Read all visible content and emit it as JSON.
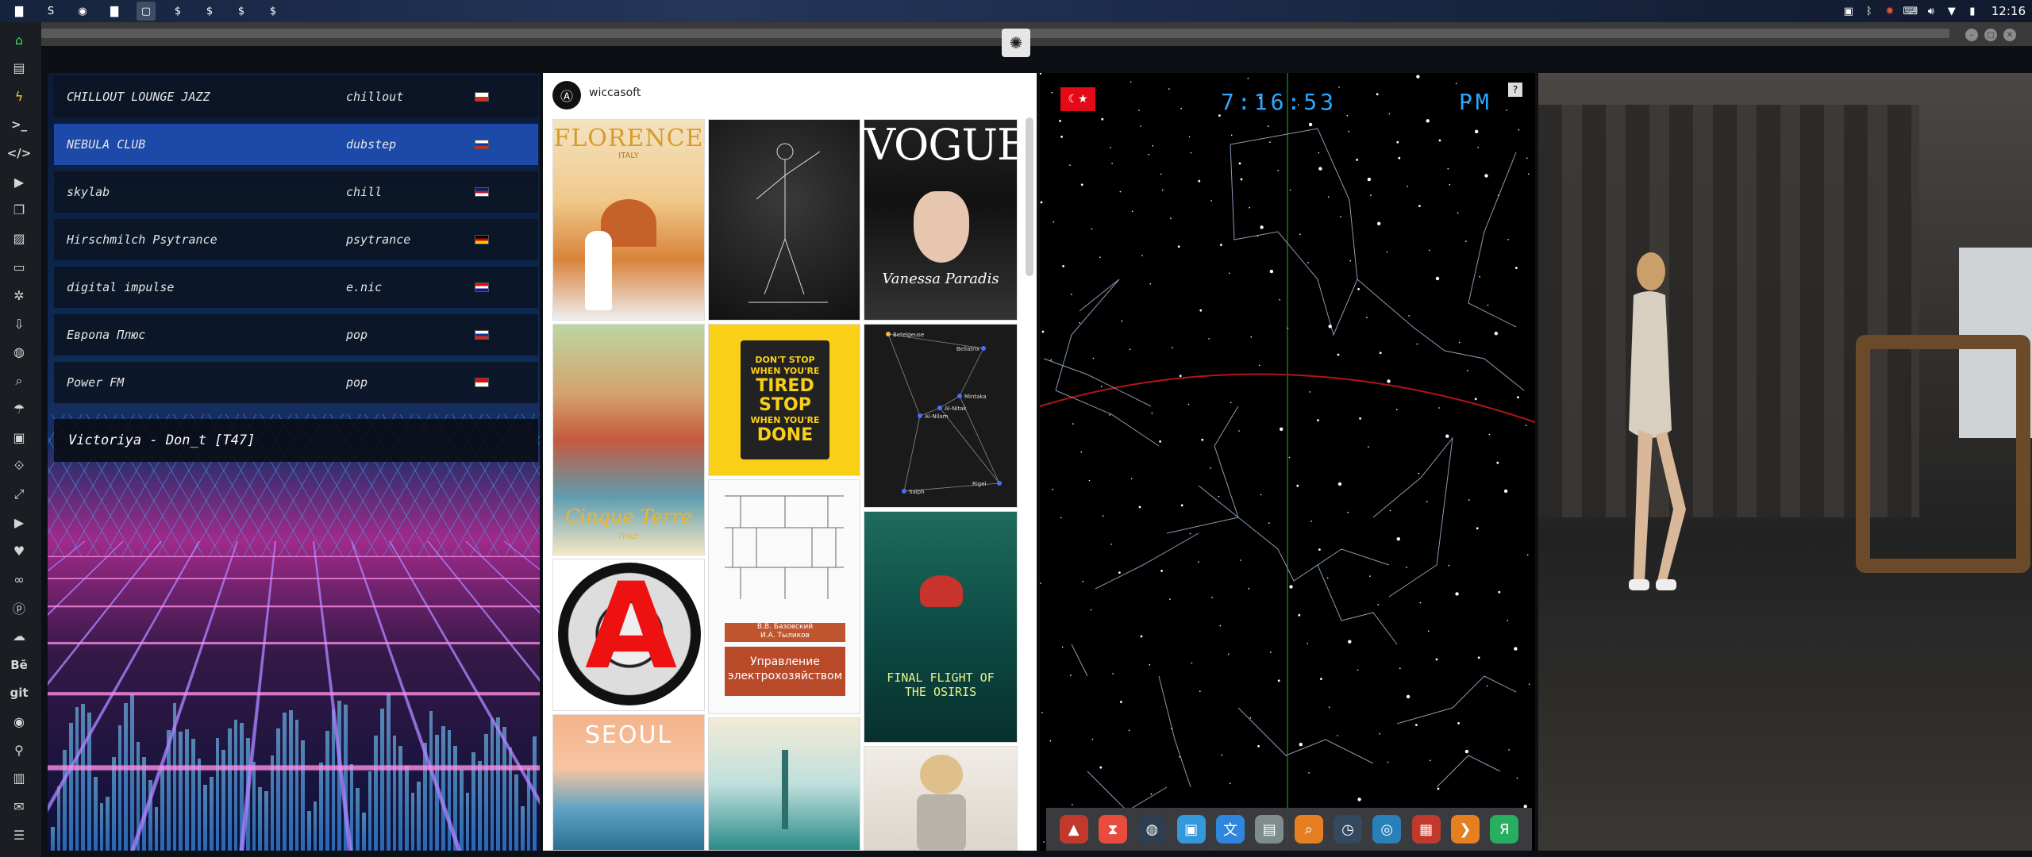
{
  "topbar": {
    "apps": [
      {
        "name": "files-icon",
        "glyph": "▇"
      },
      {
        "name": "sublime-icon",
        "glyph": "S"
      },
      {
        "name": "chrome-icon",
        "glyph": "◉"
      },
      {
        "name": "folder-icon",
        "glyph": "▇"
      },
      {
        "name": "window-icon",
        "glyph": "▢"
      },
      {
        "name": "app-icon",
        "glyph": "$"
      },
      {
        "name": "app-icon",
        "glyph": "$"
      },
      {
        "name": "app-icon",
        "glyph": "$"
      },
      {
        "name": "app-icon",
        "glyph": "$"
      }
    ],
    "clock": "12:16"
  },
  "window": {
    "logo_glyph": "✺"
  },
  "radio": {
    "stations": [
      {
        "name": "CHILLOUT LOUNGE JAZZ",
        "genre": "chillout",
        "flag_colors": [
          "#ffffff",
          "#d52b1e"
        ]
      },
      {
        "name": "NEBULA CLUB",
        "genre": "dubstep",
        "flag_colors": [
          "#ffffff",
          "#0039a6",
          "#d52b1e"
        ]
      },
      {
        "name": "skylab",
        "genre": "chill",
        "flag_colors": [
          "#012169",
          "#c8102e",
          "#ffffff"
        ]
      },
      {
        "name": "Hirschmilch Psytrance",
        "genre": "psytrance",
        "flag_colors": [
          "#000000",
          "#dd0000",
          "#ffce00"
        ]
      },
      {
        "name": "digital impulse",
        "genre": "e.nic",
        "flag_colors": [
          "#ff0000",
          "#ffffff",
          "#171796"
        ]
      },
      {
        "name": "Европа Плюс",
        "genre": "pop",
        "flag_colors": [
          "#ffffff",
          "#0039a6",
          "#d52b1e"
        ]
      },
      {
        "name": "Power FM",
        "genre": "pop",
        "flag_colors": [
          "#e30a17",
          "#ffffff"
        ]
      }
    ],
    "now_playing": "Victoriya - Don_t [T47]"
  },
  "pinterest": {
    "username": "wiccasoft",
    "avatar_glyph": "Ⓐ",
    "pins": {
      "florence_title": "FLORENCE",
      "florence_sub": "ITALY",
      "vogue_title": "VOGUE",
      "vogue_caption": "Vanessa Paradis",
      "dontstop_lines": [
        "DON'T STOP",
        "WHEN YOU'RE",
        "TIRED",
        "STOP",
        "WHEN YOU'RE",
        "DONE"
      ],
      "stars_labels": [
        "Betelgeuse",
        "Bellatrix",
        "Mintaka",
        "Al-Nitak",
        "Al-Nilam",
        "Saiph",
        "Rigel"
      ],
      "cinque_terre": "Cinque Terre",
      "cinque_sub": "ITALY",
      "book_authors": "В.В. Базовский\nИ.А. Тыликов",
      "book_title": "Управление электрохозяйством",
      "osiris_title": "FINAL FLIGHT OF THE OSIRIS",
      "seoul_title": "SEOUL"
    }
  },
  "starmap": {
    "time": "7:16:53",
    "ampm": "PM",
    "help": "?",
    "flag_glyph": "☾★"
  },
  "dock": {
    "icons": [
      {
        "name": "app-red-triangle-icon",
        "glyph": "▲",
        "color": "#c0392b"
      },
      {
        "name": "hourglass-icon",
        "glyph": "⧗",
        "color": "#e74c3c"
      },
      {
        "name": "globe-dark-icon",
        "glyph": "◍",
        "color": "#2c3e50"
      },
      {
        "name": "image-viewer-icon",
        "glyph": "▣",
        "color": "#3498db"
      },
      {
        "name": "translate-icon",
        "glyph": "文",
        "color": "#2e86de"
      },
      {
        "name": "news-icon",
        "glyph": "▤",
        "color": "#7f8c8d"
      },
      {
        "name": "search-icon",
        "glyph": "⌕",
        "color": "#e67e22"
      },
      {
        "name": "clock-icon",
        "glyph": "◷",
        "color": "#34495e"
      },
      {
        "name": "browser-icon",
        "glyph": "◎",
        "color": "#2980b9"
      },
      {
        "name": "calendar-icon",
        "glyph": "▦",
        "color": "#c0392b"
      },
      {
        "name": "arrow-icon",
        "glyph": "❯",
        "color": "#e67e22"
      },
      {
        "name": "yandex-icon",
        "glyph": "Я",
        "color": "#27ae60"
      }
    ]
  },
  "sidebar": {
    "icons": [
      {
        "name": "home-icon",
        "glyph": "⌂"
      },
      {
        "name": "document-icon",
        "glyph": "▤"
      },
      {
        "name": "bolt-icon",
        "glyph": "ϟ"
      },
      {
        "name": "terminal-icon",
        "glyph": ">_"
      },
      {
        "name": "code-icon",
        "glyph": "</>"
      },
      {
        "name": "play-icon",
        "glyph": "▶"
      },
      {
        "name": "copy-icon",
        "glyph": "❐"
      },
      {
        "name": "image-icon",
        "glyph": "▨"
      },
      {
        "name": "card-icon",
        "glyph": "▭"
      },
      {
        "name": "settings-icon",
        "glyph": "✲"
      },
      {
        "name": "download-icon",
        "glyph": "⇩"
      },
      {
        "name": "globe-icon",
        "glyph": "◍"
      },
      {
        "name": "search-icon",
        "glyph": "⌕"
      },
      {
        "name": "umbrella-icon",
        "glyph": "☂"
      },
      {
        "name": "contact-icon",
        "glyph": "▣"
      },
      {
        "name": "tag-icon",
        "glyph": "⟐"
      },
      {
        "name": "expand-icon",
        "glyph": "⤢"
      },
      {
        "name": "youtube-icon",
        "glyph": "▶"
      },
      {
        "name": "heart-icon",
        "glyph": "♥"
      },
      {
        "name": "link-icon",
        "glyph": "∞"
      },
      {
        "name": "pinterest-icon",
        "glyph": "ⓟ"
      },
      {
        "name": "cloud-icon",
        "glyph": "☁"
      },
      {
        "name": "behance-icon",
        "glyph": "Bē"
      },
      {
        "name": "git-icon",
        "glyph": "git"
      },
      {
        "name": "github-icon",
        "glyph": "◉"
      },
      {
        "name": "bike-icon",
        "glyph": "⚲"
      },
      {
        "name": "map-icon",
        "glyph": "▥"
      },
      {
        "name": "mail-icon",
        "glyph": "✉"
      },
      {
        "name": "list-icon",
        "glyph": "☰"
      }
    ]
  }
}
